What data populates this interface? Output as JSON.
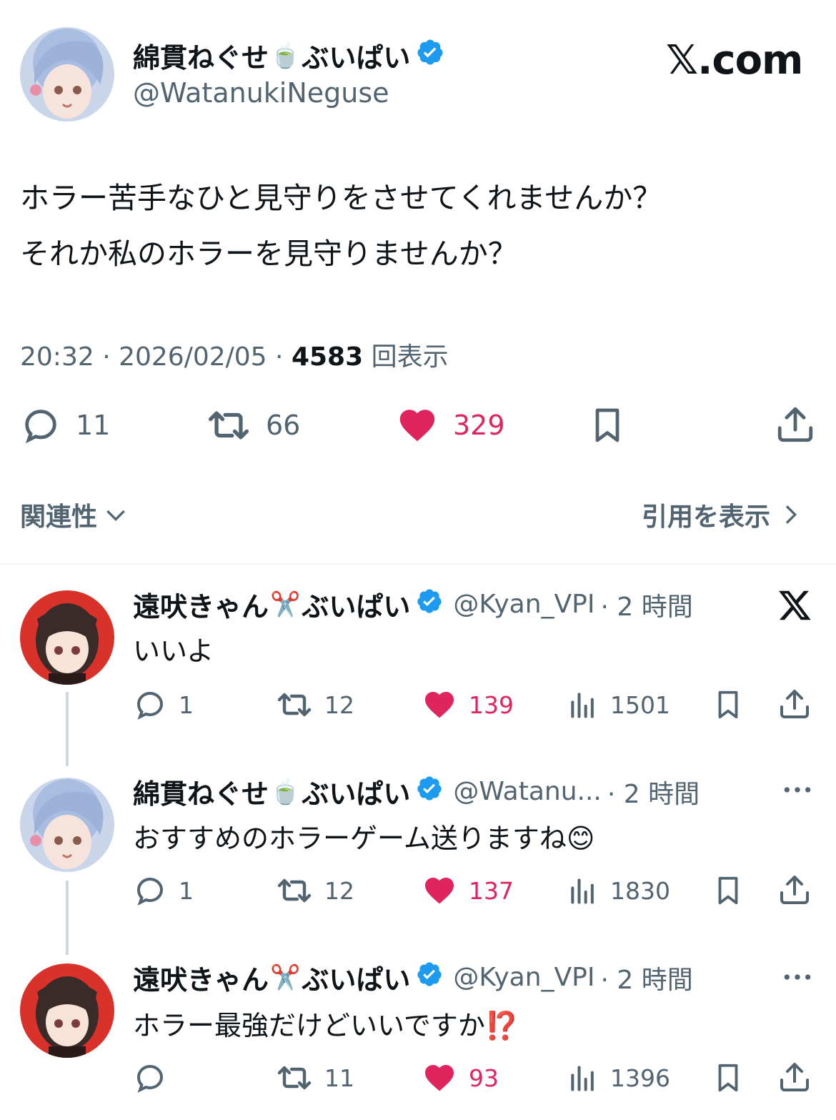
{
  "main_tweet": {
    "author_name": "綿貫ねぐせ",
    "author_emoji": "🍵",
    "author_suffix": "ぶいぱい",
    "author_handle": "@WatanukiNeguse",
    "site_label": "𝕏.com",
    "text_line1": "ホラー苦手なひと見守りをさせてくれませんか？",
    "text_line2": "それか私のホラーを見守りませんか？",
    "time": "20:32",
    "date": "2026/02/05",
    "views_count": "4583",
    "views_label": "回表示",
    "replies": "11",
    "retweets": "66",
    "likes": "329"
  },
  "sections": {
    "left": "関連性",
    "right": "引用を表示"
  },
  "replies": [
    {
      "author_name": "遠吠きゃん",
      "author_emoji": "✂️",
      "author_suffix": "ぶいぱい",
      "handle": "@Kyan_VPI",
      "time": "· 2 時間",
      "text": "いいよ",
      "replies": "1",
      "retweets": "12",
      "likes": "139",
      "views": "1501",
      "corner": "x-icon"
    },
    {
      "author_name": "綿貫ねぐせ",
      "author_emoji": "🍵",
      "author_suffix": "ぶいぱい",
      "handle": "@Watanu...",
      "time": "· 2 時間",
      "text": "おすすめのホラーゲーム送りますね😊",
      "replies": "1",
      "retweets": "12",
      "likes": "137",
      "views": "1830",
      "corner": "more-icon"
    },
    {
      "author_name": "遠吠きゃん",
      "author_emoji": "✂️",
      "author_suffix": "ぶいぱい",
      "handle": "@Kyan_VPI",
      "time": "· 2 時間",
      "text": "ホラー最強だけどいいですか⁉️",
      "replies": "",
      "retweets": "11",
      "likes": "93",
      "views": "1396",
      "corner": "more-icon"
    }
  ],
  "colors": {
    "like_red": "#e0245e",
    "gray": "#536471",
    "verified_blue": "#1d9bf0"
  }
}
